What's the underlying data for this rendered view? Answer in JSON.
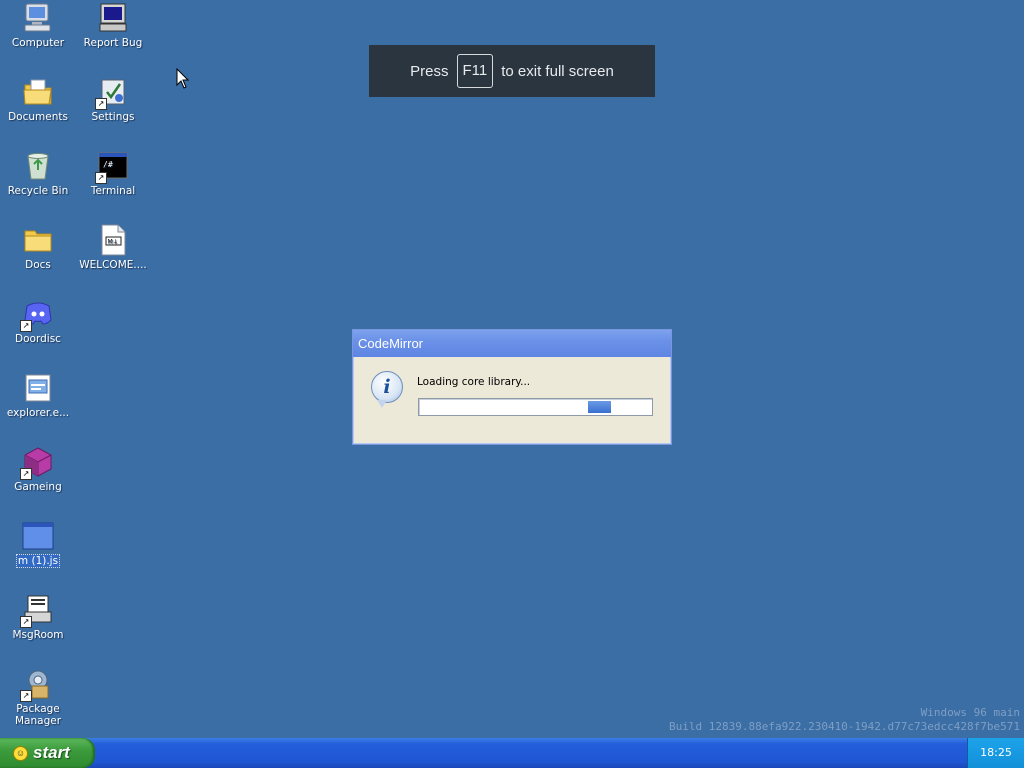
{
  "desktop": {
    "background": "#3a6ea5",
    "icons_left": [
      {
        "label": "Computer",
        "icon": "computer-icon"
      },
      {
        "label": "Documents",
        "icon": "documents-folder-icon"
      },
      {
        "label": "Recycle Bin",
        "icon": "recycle-bin-icon"
      },
      {
        "label": "Docs",
        "icon": "folder-icon"
      },
      {
        "label": "Doordisc",
        "icon": "doordisc-icon"
      },
      {
        "label": "explorer.e...",
        "icon": "explorer-icon"
      },
      {
        "label": "Gameing",
        "icon": "gameing-cube-icon"
      },
      {
        "label": "m (1).js",
        "icon": "window-file-icon",
        "selected": true
      },
      {
        "label": "MsgRoom",
        "icon": "msgroom-icon"
      },
      {
        "label": "Package Manager",
        "icon": "package-manager-icon"
      }
    ],
    "icons_right": [
      {
        "label": "Report Bug",
        "icon": "report-bug-icon"
      },
      {
        "label": "Settings",
        "icon": "settings-icon"
      },
      {
        "label": "Terminal",
        "icon": "terminal-icon"
      },
      {
        "label": "WELCOME....",
        "icon": "markdown-file-icon"
      }
    ]
  },
  "fullscreen_notice": {
    "prefix": "Press",
    "key": "F11",
    "suffix": "to exit full screen"
  },
  "dialog": {
    "title": "CodeMirror",
    "message": "Loading core library...",
    "icon": "info-icon"
  },
  "watermark": {
    "line1": "Windows 96 main",
    "line2": "Build 12839.88efa922.230410-1942.d77c73edcc428f7be571"
  },
  "taskbar": {
    "start_label": "start",
    "clock": "18:25"
  }
}
